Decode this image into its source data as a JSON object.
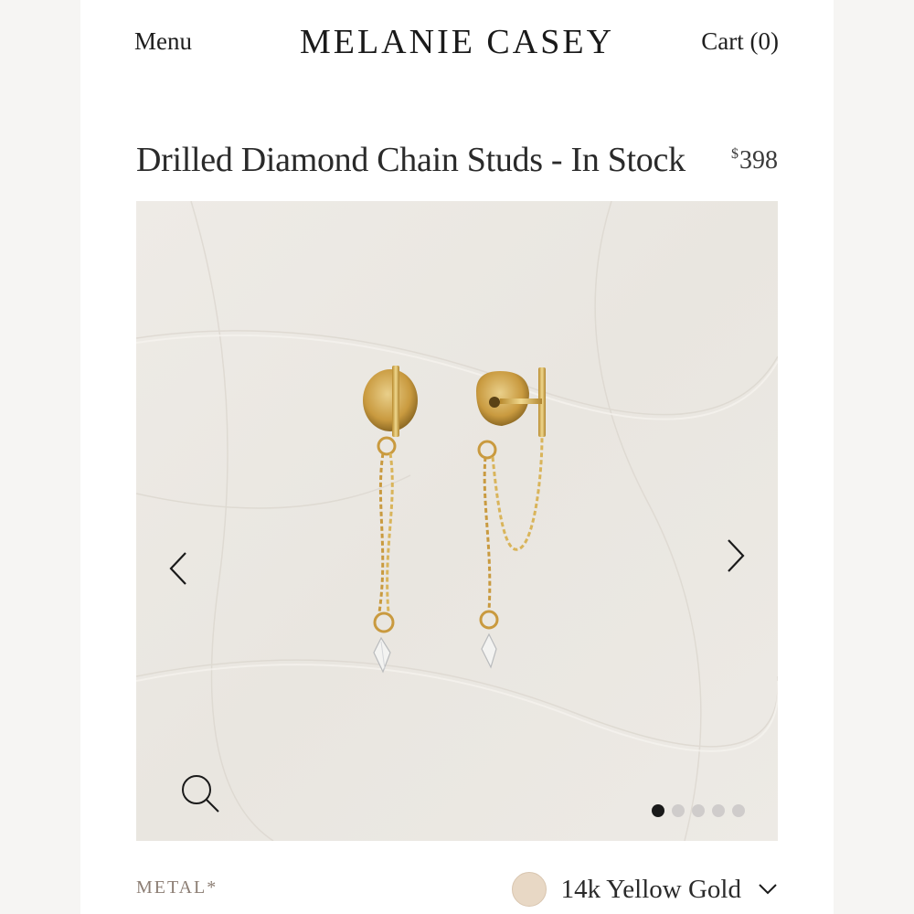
{
  "header": {
    "menu_label": "Menu",
    "brand": "MELANIE CASEY",
    "cart_label": "Cart (0)"
  },
  "product": {
    "title": "Drilled Diamond Chain Studs - In Stock",
    "currency_symbol": "$",
    "price": "398"
  },
  "gallery": {
    "slide_count": 5,
    "active_slide": 1,
    "icons": {
      "prev": "chevron-left-icon",
      "next": "chevron-right-icon",
      "zoom": "magnifier-icon"
    }
  },
  "options": {
    "metal_label": "METAL*",
    "metal_value": "14k Yellow Gold",
    "metal_swatch_color": "#e8d8c5",
    "dropdown_icon": "chevron-down-icon"
  },
  "colors": {
    "gold": "#d8b45a",
    "gallery_bg": "#ece9e4",
    "label_muted": "#8c7e74"
  }
}
